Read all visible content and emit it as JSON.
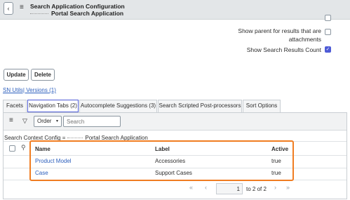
{
  "header": {
    "title_line1": "Search Application Configuration",
    "title_line2": "Portal Search Application",
    "back_icon": "chevron-left",
    "menu_icon": "hamburger"
  },
  "form": {
    "show_parent_label_line1": "Show parent for results that are",
    "show_parent_label_line2": "attachments",
    "show_parent_checked": false,
    "show_count_label": "Show Search Results Count",
    "show_count_checked": true
  },
  "actions": {
    "update": "Update",
    "delete": "Delete"
  },
  "related_links": "SN Utils| Versions (1)",
  "tabs": [
    {
      "label": "Facets",
      "active": false
    },
    {
      "label": "Navigation Tabs (2)",
      "active": true
    },
    {
      "label": "Autocomplete Suggestions (3)",
      "active": false
    },
    {
      "label": "Search Scripted Post-processors",
      "active": false
    },
    {
      "label": "Sort Options",
      "active": false
    }
  ],
  "list": {
    "search_field_select": "Order",
    "search_placeholder": "Search",
    "context_prefix": "Search Context Config =",
    "context_value": "Portal Search Application",
    "columns": {
      "name": "Name",
      "label": "Label",
      "active": "Active"
    },
    "rows": [
      {
        "name": "Product Model",
        "label": "Accessories",
        "active": "true"
      },
      {
        "name": "Case",
        "label": "Support Cases",
        "active": "true"
      }
    ],
    "pager": {
      "current": "1",
      "range_text": "to 2 of 2"
    }
  },
  "colors": {
    "accent": "#4e5bd6",
    "highlight": "#f07d22",
    "link": "#2c5fbd"
  }
}
